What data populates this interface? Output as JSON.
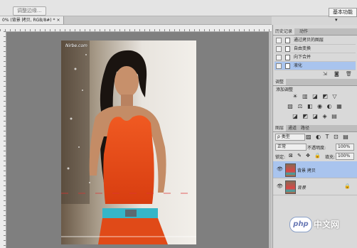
{
  "toolbar": {
    "adjust_button": "调整边缘...",
    "workspace": "基本功能"
  },
  "document": {
    "tab_title": "0% (背景 拷贝, RGB/8#) *",
    "close": "×",
    "watermark": "Nirbe.com"
  },
  "history_panel": {
    "tabs": [
      "历史记录",
      "动作"
    ],
    "items": [
      {
        "label": "通过拷贝的图层",
        "selected": false
      },
      {
        "label": "自由变换",
        "selected": false
      },
      {
        "label": "向下合并",
        "selected": false
      },
      {
        "label": "液化",
        "selected": true
      }
    ]
  },
  "adjustments_panel": {
    "tab": "调整",
    "title": "添加调整",
    "row1": "☀ ▥ ◪ ◩ ▽",
    "row2": "▧ ⚖ ◧ ◉ ◐ ▦",
    "row3": "◪ ◩ ◪ ◈ ▤"
  },
  "layers_panel": {
    "tabs": [
      "图层",
      "通道",
      "路径"
    ],
    "filter_kind": "ρ 类型",
    "blend_mode": "正常",
    "opacity_label": "不透明度:",
    "opacity_value": "100%",
    "lock_label": "锁定:",
    "fill_label": "填充:",
    "fill_value": "100%",
    "layers": [
      {
        "name": "背景 拷贝",
        "selected": true,
        "visible": true,
        "locked": false
      },
      {
        "name": "背景",
        "selected": false,
        "visible": true,
        "locked": true
      }
    ]
  },
  "logo": {
    "badge": "php",
    "text": "中文网"
  }
}
